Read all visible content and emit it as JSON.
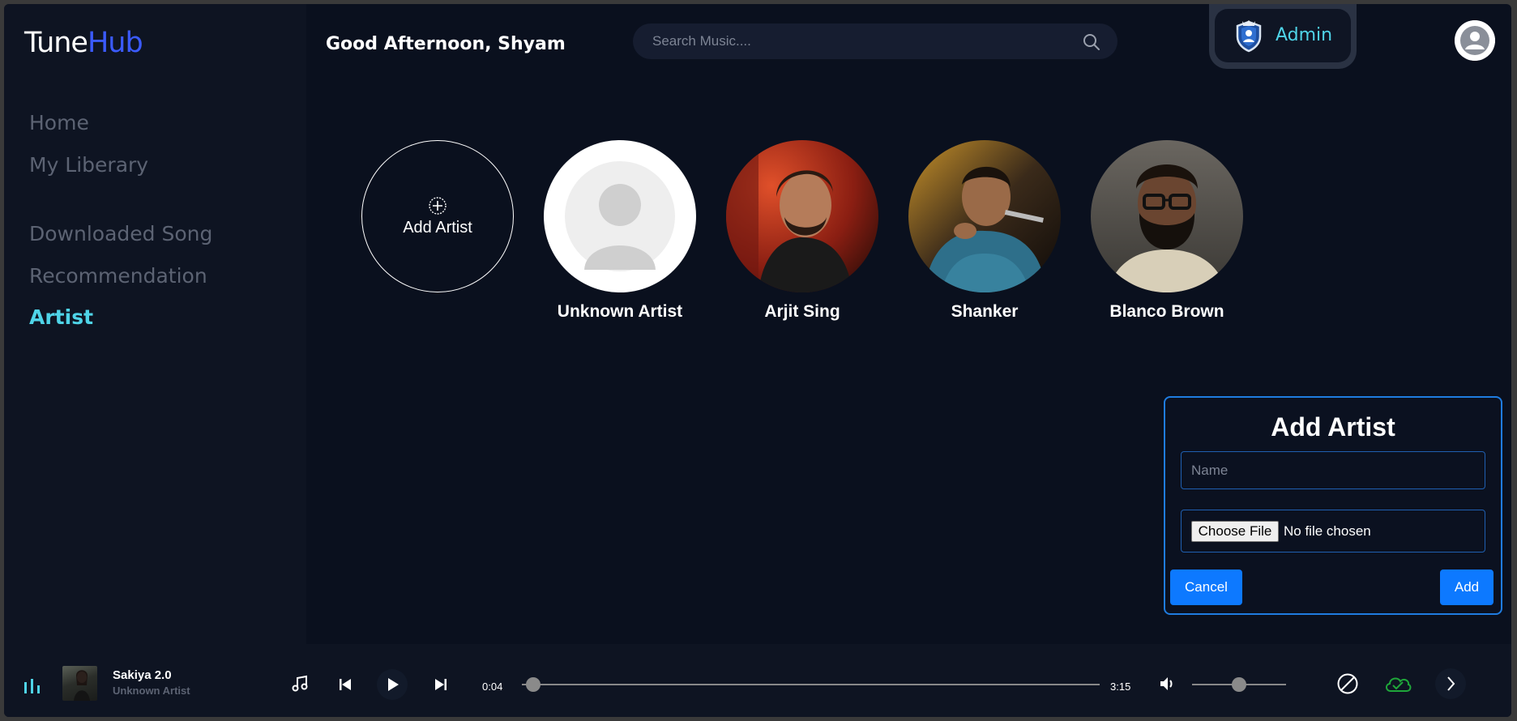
{
  "brand": {
    "part1": "Tune",
    "part2": "Hub"
  },
  "sidebar": {
    "items": [
      {
        "label": "Home",
        "active": false
      },
      {
        "label": "My Liberary",
        "active": false
      },
      {
        "label": "Downloaded Song",
        "active": false
      },
      {
        "label": "Recommendation",
        "active": false
      },
      {
        "label": "Artist",
        "active": true
      }
    ]
  },
  "header": {
    "greeting": "Good Afternoon, Shyam",
    "search_placeholder": "Search Music....",
    "admin_label": "Admin"
  },
  "artists": {
    "add_label": "Add Artist",
    "items": [
      {
        "name": "Unknown Artist"
      },
      {
        "name": "Arjit Sing"
      },
      {
        "name": "Shanker"
      },
      {
        "name": "Blanco Brown"
      }
    ]
  },
  "dialog": {
    "title": "Add Artist",
    "name_placeholder": "Name",
    "choose_file_label": "Choose File",
    "file_status": "No file chosen",
    "cancel_label": "Cancel",
    "add_label": "Add"
  },
  "player": {
    "song_title": "Sakiya 2.0",
    "song_artist": "Unknown Artist",
    "current_time": "0:04",
    "total_time": "3:15",
    "progress_fraction": 0.02,
    "volume_fraction": 0.5
  },
  "colors": {
    "accent": "#4fd4e8",
    "brand_blue": "#3b5bff",
    "dialog_border": "#1f7ce0",
    "button_blue": "#0d79ff",
    "cloud_green": "#1fa63a"
  }
}
